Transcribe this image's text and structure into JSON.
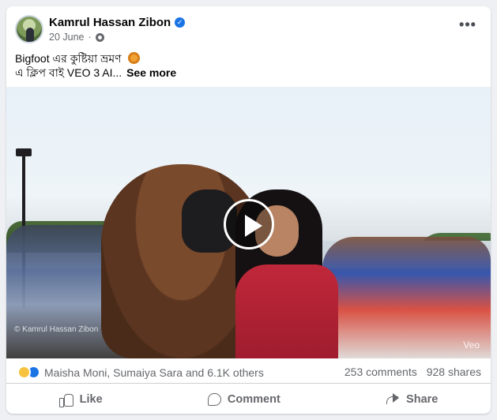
{
  "post": {
    "author": "Kamrul Hassan Zibon",
    "date": "20 June",
    "separator": "·",
    "text_line1": "Bigfoot এর কুষ্টিয়া ভ্রমণ",
    "text_line2": "এ ক্লিপ বাই VEO 3 AI...",
    "see_more": "See more",
    "more_label": "•••"
  },
  "video": {
    "watermark": "© Kamrul Hassan Zibon",
    "veo_mark": "Veo"
  },
  "stats": {
    "reactions_text": "Maisha Moni, Sumaiya Sara and 6.1K others",
    "comments": "253 comments",
    "shares": "928 shares"
  },
  "actions": {
    "like": "Like",
    "comment": "Comment",
    "share": "Share"
  },
  "colors": {
    "brand_blue": "#1b74e4",
    "muted_text": "#65676b",
    "card_bg": "#ffffff",
    "page_bg": "#eef0f3"
  },
  "icons": [
    "verified-icon",
    "globe-icon",
    "more-options-icon",
    "play-icon",
    "haha-reaction-icon",
    "like-reaction-icon",
    "like-icon",
    "comment-icon",
    "share-icon"
  ]
}
